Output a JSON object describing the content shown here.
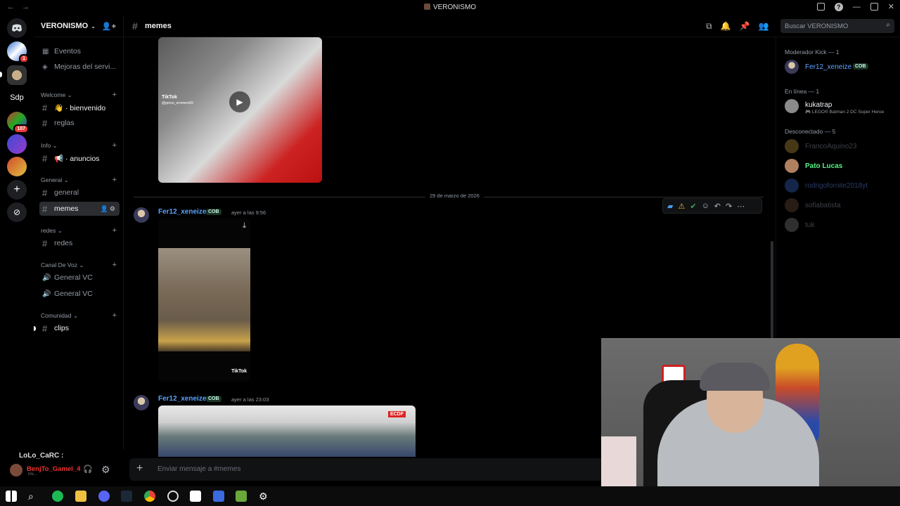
{
  "window": {
    "title": "VERONISMO"
  },
  "servers": [
    {
      "name": "server-1",
      "badge": "1"
    },
    {
      "name": "server-2",
      "badge": ""
    },
    {
      "name": "server-sdp",
      "label": "Sdp"
    },
    {
      "name": "server-4",
      "badge": "107"
    },
    {
      "name": "server-5",
      "badge": ""
    },
    {
      "name": "server-6",
      "badge": ""
    }
  ],
  "sidebar": {
    "server_name": "VERONISMO",
    "top_items": [
      {
        "label": "Eventos"
      },
      {
        "label": "Mejoras del servi..."
      }
    ],
    "categories": [
      {
        "name": "Welcome",
        "channels": [
          "👋 · bienvenido",
          "reglas"
        ]
      },
      {
        "name": "Info",
        "channels": [
          "📢 · anuncios"
        ]
      },
      {
        "name": "General",
        "channels": [
          "general",
          "memes"
        ]
      },
      {
        "name": "redes",
        "channels": [
          "redes"
        ]
      },
      {
        "name": "Canal De Voz",
        "channels": [
          "General VC",
          "General VC"
        ]
      },
      {
        "name": "Comunidad",
        "channels": [
          "clips"
        ]
      }
    ]
  },
  "userbar": {
    "overlay_name": "LoLo_CaRC :",
    "username": "BenjTo_Gamel_4",
    "status": "inv..."
  },
  "channel": {
    "name": "memes"
  },
  "header": {
    "search_placeholder": "Buscar VERONISMO"
  },
  "messages": {
    "date_divider": "29 de marzo de 2026",
    "items": [
      {
        "author": "Fer12_xeneize",
        "tag": "COB",
        "timestamp": "ayer a las 9:56"
      },
      {
        "author": "Fer12_xeneize",
        "tag": "COB",
        "timestamp": "ayer a las 23:03"
      }
    ],
    "tiktok_label": "TikTok",
    "tiktok_handle": "@geroo_eromero69",
    "video3_badge": "ECDF"
  },
  "composer": {
    "placeholder": "Enviar mensaje a #memes"
  },
  "members": {
    "groups": [
      {
        "title": "Moderador Kick — 1",
        "members": [
          {
            "name": "Fer12_xeneize",
            "tag": "COB",
            "color": "#5ba3ff"
          }
        ]
      },
      {
        "title": "En línea — 1",
        "members": [
          {
            "name": "kukatrap",
            "status": "🎮 LEGO® Batman 2 DC Super Heroe"
          }
        ]
      },
      {
        "title": "Desconectado — 5",
        "members": [
          {
            "name": "FrancoAquino23"
          },
          {
            "name": "Pato Lucas",
            "color": "#57f287"
          },
          {
            "name": "rodrigofornite2018yt"
          },
          {
            "name": "sofiabatista"
          },
          {
            "name": "tuk"
          }
        ]
      }
    ]
  }
}
